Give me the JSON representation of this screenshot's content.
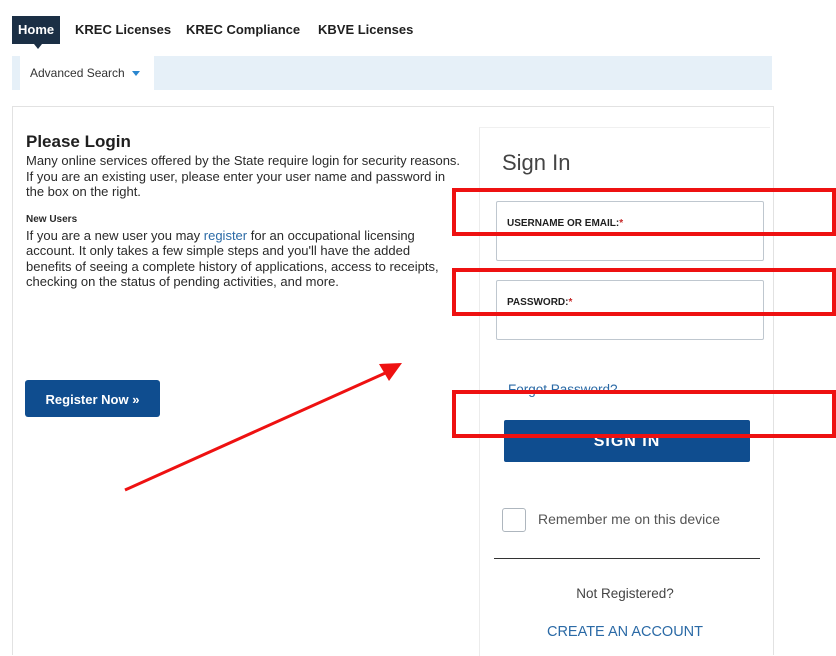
{
  "nav": {
    "home": "Home",
    "krec_licenses": "KREC Licenses",
    "krec_compliance": "KREC Compliance",
    "kbve_licenses": "KBVE Licenses"
  },
  "subnav": {
    "advanced_search": "Advanced Search"
  },
  "login": {
    "title": "Please Login",
    "description": "Many online services offered by the State require login for security reasons. If you are an existing user, please enter your user name and password in the box on the right.",
    "new_users_label": "New Users",
    "new_users_text_before": "If you are a new user you may ",
    "register_link": "register",
    "new_users_text_after": " for an occupational licensing account. It only takes a few simple steps and you'll have the added benefits of seeing a complete history of applications, access to receipts, checking on the status of pending activities, and more.",
    "register_button": "Register Now »"
  },
  "signin": {
    "title": "Sign In",
    "username_label": "USERNAME OR EMAIL:",
    "password_label": "PASSWORD:",
    "required_mark": "*",
    "username_value": "",
    "password_value": "",
    "forgot_password": "Forgot Password?",
    "signin_button": "SIGN IN",
    "remember_label": "Remember me on this device",
    "remember_checked": false,
    "not_registered": "Not Registered?",
    "create_account": "CREATE AN ACCOUNT"
  },
  "colors": {
    "nav_active_bg": "#1b2f45",
    "primary_button": "#0f4d8f",
    "link": "#2b6aa6",
    "subbar_bg": "#e6f0f8",
    "annotation": "#ee1111"
  }
}
